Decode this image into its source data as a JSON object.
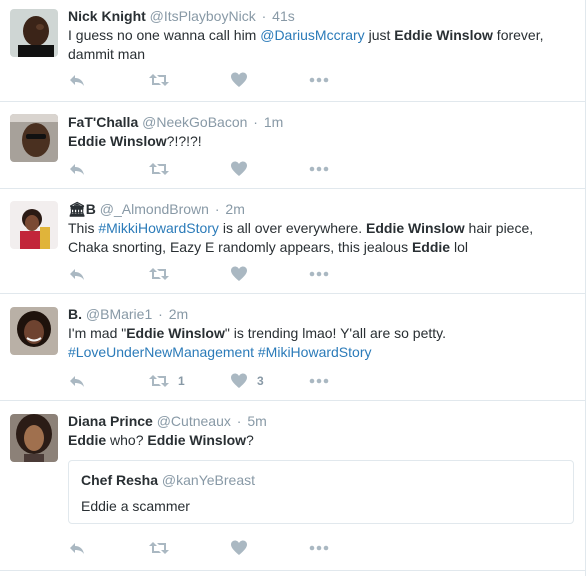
{
  "tweets": [
    {
      "name": "Nick Knight",
      "handle": "@ItsPlayboyNick",
      "time": "41s",
      "text": {
        "p1": "I guess no one wanna call him ",
        "mention": "@DariusMccrary",
        "p2": " just ",
        "bold": "Eddie Winslow",
        "p3": " forever,",
        "line2": "dammit man"
      }
    },
    {
      "name": "FaT'Challa",
      "handle": "@NeekGoBacon",
      "time": "1m",
      "text": {
        "bold": "Eddie Winslow",
        "rest": "?!?!?!"
      }
    },
    {
      "name_icon": "🏛",
      "name": "B",
      "handle": "@_AlmondBrown",
      "time": "2m",
      "text": {
        "p1": "This ",
        "hashtag": "#MikkiHowardStory",
        "p2": " is all over everywhere. ",
        "bold1": "Eddie Winslow",
        "p3": " hair piece,",
        "line2a": "Chaka snorting, Eazy E randomly appears, this jealous ",
        "bold2": "Eddie",
        "line2b": " lol"
      }
    },
    {
      "name": "B.",
      "handle": "@BMarie1",
      "time": "2m",
      "text": {
        "p1": "I'm mad \"",
        "bold": "Eddie Winslow",
        "p2": "\" is trending lmao! Y'all are so petty.",
        "hashtag1": "#LoveUnderNewManagement",
        "hashtag2": "#MikiHowardStory"
      },
      "retweets": "1",
      "likes": "3"
    },
    {
      "name": "Diana Prince",
      "handle": "@Cutneaux",
      "time": "5m",
      "text": {
        "bold1": "Eddie",
        "p1": " who? ",
        "bold2": "Eddie Winslow",
        "p2": "?"
      },
      "quote": {
        "name": "Chef Resha",
        "handle": "@kanYeBreast",
        "text": "Eddie a scammer"
      }
    }
  ],
  "dot": "·",
  "icons": [
    "reply-icon",
    "retweet-icon",
    "like-icon",
    "more-icon"
  ],
  "colors": {
    "link": "#2b7bb9",
    "meta": "#8899a6",
    "action": "#aab8c2",
    "border": "#e1e8ed"
  }
}
